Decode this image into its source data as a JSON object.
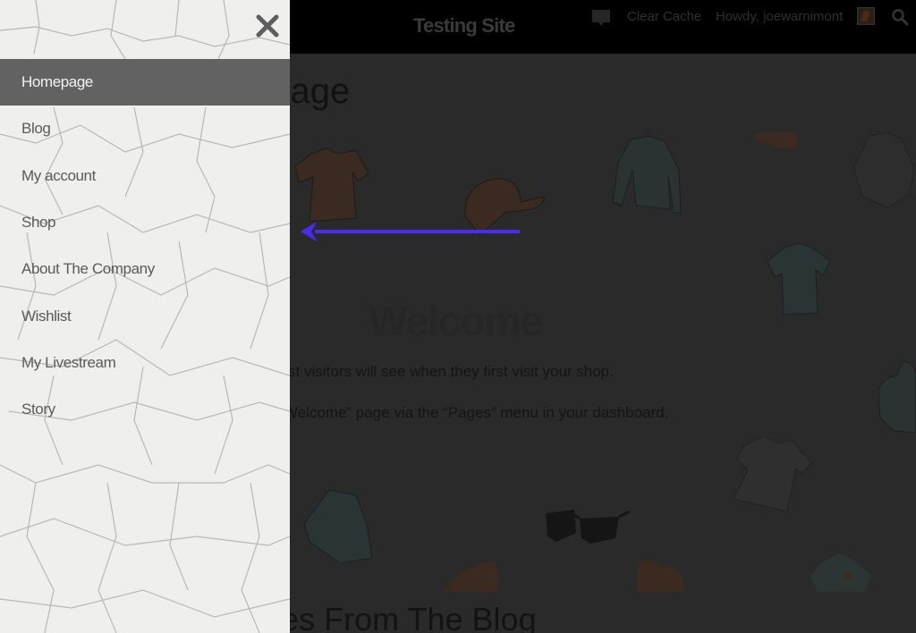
{
  "header": {
    "site_title": "Testing Site",
    "admin_bar": {
      "comments_icon": "comment-icon",
      "clear_cache_label": "Clear Cache",
      "howdy_label": "Howdy, joewarnimont",
      "avatar_icon": "avatar",
      "search_icon": "search-icon"
    }
  },
  "page": {
    "title_partial": "age",
    "hero": {
      "heading": "Welcome",
      "line_1": "This is your homepage which is what most visitors will see when they first visit your shop.",
      "line_2": "You can change this text by editing the “Welcome” page via the “Pages” menu in your dashboard."
    },
    "blog_heading": "Latest Updates From The Blog"
  },
  "drawer": {
    "close_icon": "close-icon",
    "items": [
      {
        "label": "Homepage",
        "active": true
      },
      {
        "label": "Blog",
        "active": false
      },
      {
        "label": "My account",
        "active": false
      },
      {
        "label": "Shop",
        "active": false
      },
      {
        "label": "About The Company",
        "active": false
      },
      {
        "label": "Wishlist",
        "active": false
      },
      {
        "label": "My Livestream",
        "active": false
      },
      {
        "label": "Story",
        "active": false
      }
    ]
  },
  "annotation": {
    "arrow_color": "#4a2cf0",
    "direction": "left"
  },
  "colors": {
    "overlay_bg": "#2a2a2a",
    "header_bg": "#000000",
    "drawer_bg": "#efefee",
    "active_item_bg": "#626262"
  }
}
